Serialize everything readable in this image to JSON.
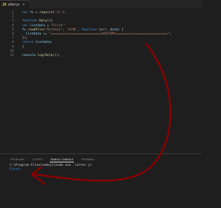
{
  "tab": {
    "icon": "JS",
    "label": "alter.js",
    "close": "×"
  },
  "editor": {
    "lines": [
      {
        "n": "1",
        "tokens": [
          [
            "kw",
            "var "
          ],
          [
            "var",
            "fs"
          ],
          [
            "punc",
            " = "
          ],
          [
            "fn",
            "require"
          ],
          [
            "punc",
            "("
          ],
          [
            "str",
            "'fs'"
          ],
          [
            "punc",
            ");"
          ]
        ]
      },
      {
        "n": "2",
        "tokens": []
      },
      {
        "n": "3",
        "tokens": [
          [
            "kw",
            "function "
          ],
          [
            "fn",
            "Help"
          ],
          [
            "punc",
            "(){"
          ]
        ]
      },
      {
        "n": "4",
        "tokens": [
          [
            "kw",
            "var "
          ],
          [
            "var",
            "listdata"
          ],
          [
            "punc",
            " = "
          ],
          [
            "str",
            "\"First:\""
          ]
        ]
      },
      {
        "n": "5",
        "tokens": [
          [
            "var",
            "fs"
          ],
          [
            "punc",
            "."
          ],
          [
            "fn",
            "readFile"
          ],
          [
            "punc",
            "("
          ],
          [
            "str",
            "\"History\""
          ],
          [
            "punc",
            ", "
          ],
          [
            "str",
            "'utf8'"
          ],
          [
            "punc",
            ", "
          ],
          [
            "kw",
            "function "
          ],
          [
            "punc",
            "("
          ],
          [
            "var",
            "err"
          ],
          [
            "punc",
            ", "
          ],
          [
            "var",
            "data"
          ],
          [
            "punc",
            ") {"
          ]
        ]
      },
      {
        "n": "6",
        "tokens": [
          [
            "punc",
            "  "
          ],
          [
            "var",
            "listdata"
          ],
          [
            "punc",
            " += "
          ],
          [
            "str",
            "\"===========================HISTORY===========================\""
          ],
          [
            "punc",
            ";"
          ]
        ]
      },
      {
        "n": "7",
        "tokens": [
          [
            "punc",
            "});"
          ]
        ]
      },
      {
        "n": "8",
        "tokens": [
          [
            "kw",
            "return "
          ],
          [
            "var",
            "listdata"
          ],
          [
            "punc",
            ";"
          ]
        ]
      },
      {
        "n": "9",
        "tokens": [
          [
            "punc",
            "}"
          ]
        ]
      },
      {
        "n": "10",
        "tokens": []
      },
      {
        "n": "11",
        "tokens": [
          [
            "var",
            "console"
          ],
          [
            "punc",
            "."
          ],
          [
            "fn",
            "log"
          ],
          [
            "punc",
            "("
          ],
          [
            "fn",
            "Help"
          ],
          [
            "punc",
            "());"
          ]
        ]
      }
    ]
  },
  "panel": {
    "tabs": [
      {
        "label": "Problems",
        "active": false
      },
      {
        "label": "Output",
        "active": false
      },
      {
        "label": "Debug Console",
        "active": true
      },
      {
        "label": "Terminal",
        "active": false
      }
    ],
    "command": "C:\\Program Files\\nodejs\\node.exe .\\alter.js",
    "output": "First:"
  },
  "annotation": {
    "color": "#8b0000"
  }
}
